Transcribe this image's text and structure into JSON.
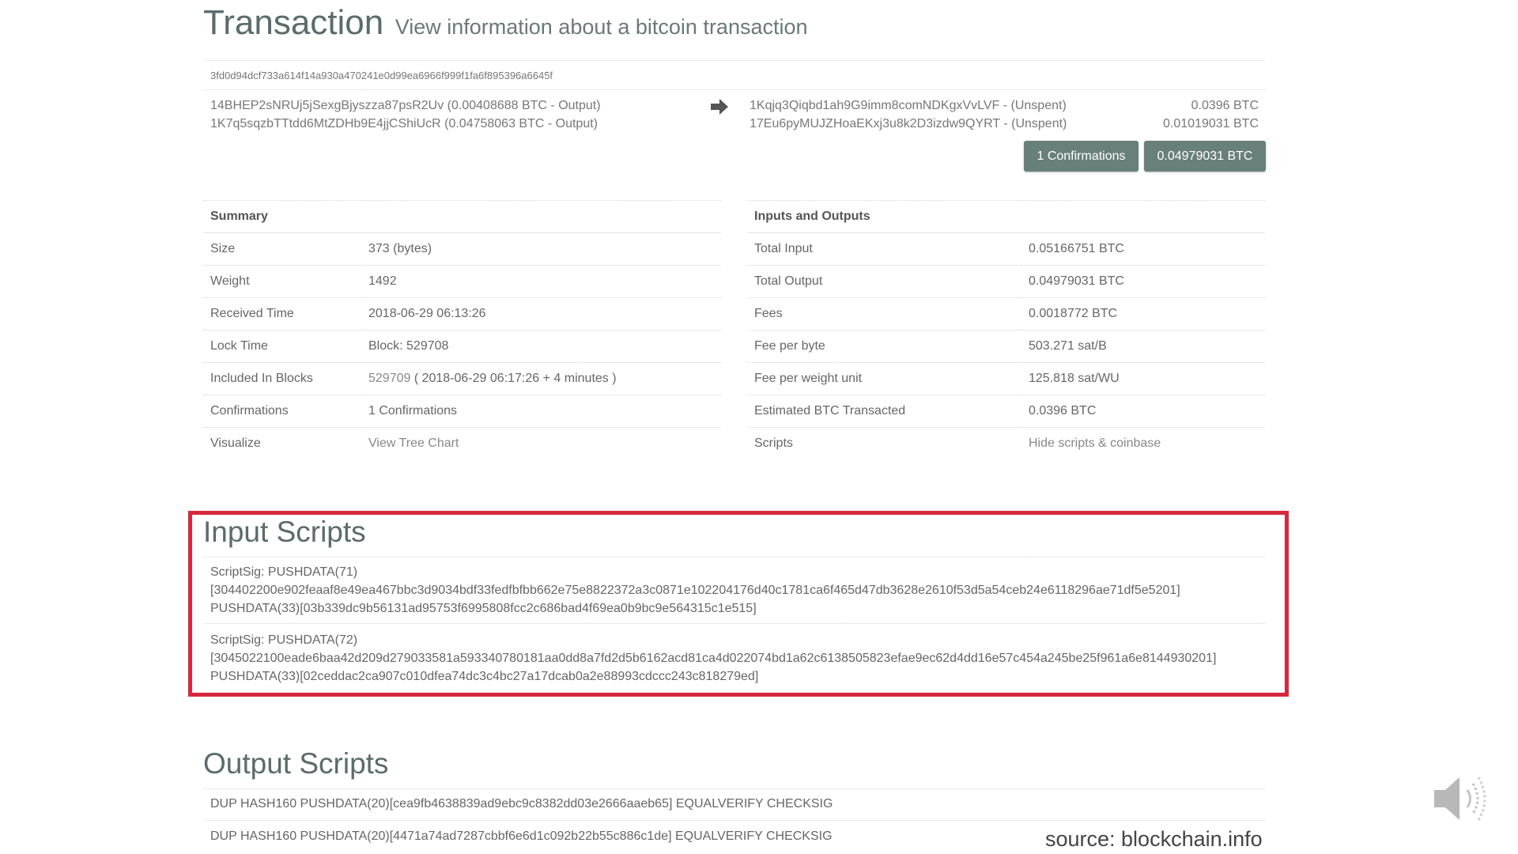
{
  "header": {
    "title": "Transaction",
    "subtitle": "View information about a bitcoin transaction"
  },
  "transaction": {
    "hash": "3fd0d94dcf733a614f14a930a470241e0d99ea6966f999f1fa6f895396a6645f",
    "inputs": [
      "14BHEP2sNRUj5jSexgBjyszza87psR2Uv (0.00408688 BTC - Output)",
      "1K7q5sqzbTTtdd6MtZDHb9E4jjCShiUcR (0.04758063 BTC - Output)"
    ],
    "outputs": [
      {
        "address": "1Kqjq3Qiqbd1ah9G9imm8comNDKgxVvLVF - (Unspent)",
        "amount": "0.0396 BTC"
      },
      {
        "address": "17Eu6pyMUJZHoaEKxj3u8k2D3izdw9QYRT - (Unspent)",
        "amount": "0.01019031 BTC"
      }
    ],
    "confirmations_button": "1 Confirmations",
    "total_button": "0.04979031 BTC"
  },
  "summary": {
    "heading": "Summary",
    "rows": [
      {
        "label": "Size",
        "value": "373 (bytes)"
      },
      {
        "label": "Weight",
        "value": "1492"
      },
      {
        "label": "Received Time",
        "value": "2018-06-29 06:13:26"
      },
      {
        "label": "Lock Time",
        "value": "Block: 529708"
      },
      {
        "label": "Included In Blocks",
        "value_link": "529709",
        "value_rest": " ( 2018-06-29 06:17:26 + 4 minutes )"
      },
      {
        "label": "Confirmations",
        "value": "1 Confirmations"
      },
      {
        "label": "Visualize",
        "value": "View Tree Chart"
      }
    ]
  },
  "io": {
    "heading": "Inputs and Outputs",
    "rows": [
      {
        "label": "Total Input",
        "value": "0.05166751 BTC"
      },
      {
        "label": "Total Output",
        "value": "0.04979031 BTC"
      },
      {
        "label": "Fees",
        "value": "0.0018772 BTC"
      },
      {
        "label": "Fee per byte",
        "value": "503.271 sat/B"
      },
      {
        "label": "Fee per weight unit",
        "value": "125.818 sat/WU"
      },
      {
        "label": "Estimated BTC Transacted",
        "value": "0.0396 BTC"
      },
      {
        "label": "Scripts",
        "value": "Hide scripts & coinbase"
      }
    ]
  },
  "input_scripts": {
    "title": "Input Scripts",
    "scripts": [
      {
        "line1": "ScriptSig: PUSHDATA(71)",
        "line2": "[304402200e902feaaf8e49ea467bbc3d9034bdf33fedfbfbb662e75e8822372a3c0871e102204176d40c1781ca6f465d47db3628e2610f53d5a54ceb24e6118296ae71df5e5201]",
        "line3": "PUSHDATA(33)[03b339dc9b56131ad95753f6995808fcc2c686bad4f69ea0b9bc9e564315c1e515]"
      },
      {
        "line1": "ScriptSig: PUSHDATA(72)",
        "line2": "[3045022100eade6baa42d209d279033581a593340780181aa0dd8a7fd2d5b6162acd81ca4d022074bd1a62c6138505823efae9ec62d4dd16e57c454a245be25f961a6e8144930201]",
        "line3": "PUSHDATA(33)[02ceddac2ca907c010dfea74dc3c4bc27a17dcab0a2e88993cdccc243c818279ed]"
      }
    ]
  },
  "output_scripts": {
    "title": "Output Scripts",
    "lines": [
      "DUP HASH160 PUSHDATA(20)[cea9fb4638839ad9ebc9c8382dd03e2666aaeb65] EQUALVERIFY CHECKSIG",
      "DUP HASH160 PUSHDATA(20)[4471a74ad7287cbbf6e6d1c092b22b55c886c1de] EQUALVERIFY CHECKSIG"
    ]
  },
  "footer": {
    "source": "source: blockchain.info"
  },
  "icons": {
    "arrow": "arrow-right-icon",
    "speaker": "speaker-icon"
  },
  "colors": {
    "button": "#69807a",
    "highlight_box": "#d6283c",
    "title": "#5c6b6b"
  }
}
